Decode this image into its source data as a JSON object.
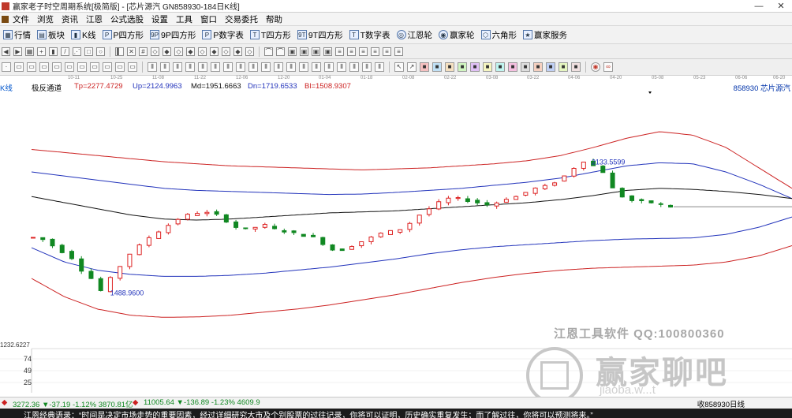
{
  "window": {
    "title": "赢家老子时空周期系统[极简版] - [芯片源汽  GN858930-184日K线]",
    "minimize": "—",
    "close": "✕"
  },
  "menu": [
    "文件",
    "浏览",
    "资讯",
    "江恩",
    "公式选股",
    "设置",
    "工具",
    "窗口",
    "交易委托",
    "帮助"
  ],
  "toolbar": [
    {
      "label": "行情",
      "icon": "grid-icon"
    },
    {
      "label": "板块",
      "icon": "block-icon"
    },
    {
      "label": "K线",
      "icon": "kline-icon"
    },
    {
      "label": "P四方形",
      "icon": "P"
    },
    {
      "label": "9P四方形",
      "icon": "9P"
    },
    {
      "label": "P数字表",
      "icon": "P"
    },
    {
      "label": "T四方形",
      "icon": "T"
    },
    {
      "label": "9T四方形",
      "icon": "9T"
    },
    {
      "label": "T数字表",
      "icon": "T"
    },
    {
      "label": "江恩轮",
      "icon": "wheel-icon"
    },
    {
      "label": "赢家轮",
      "icon": "wheel-icon"
    },
    {
      "label": "六角形",
      "icon": "hexagon-icon"
    },
    {
      "label": "赢家服务",
      "icon": "service-icon"
    }
  ],
  "date_ticks": [
    "10-11",
    "10-25",
    "11-08",
    "11-22",
    "12-06",
    "12-20",
    "01-04",
    "01-18",
    "02-08",
    "02-22",
    "03-08",
    "03-22",
    "04-06",
    "04-20",
    "05-08",
    "05-23",
    "06-06",
    "06-20"
  ],
  "indicator": {
    "panel_label": "K线",
    "name": "极反通道",
    "tp": "Tp=2277.4729",
    "up": "Up=2124.9963",
    "md": "Md=1951.6663",
    "dn": "Dn=1719.6533",
    "bl": "Bl=1508.9307",
    "security": "858930  芯片源汽"
  },
  "annotations": {
    "high": "2133.5599",
    "low": "1488.9600",
    "left_axis_value": "1232.6227"
  },
  "sub_axis": [
    "74",
    "49",
    "25"
  ],
  "status": {
    "sh": "3272.36 ▼-37.19 -1.12% 3870.81亿",
    "sz": "11005.64 ▼-136.89 -1.23% 4609.9",
    "right": "收858930日线"
  },
  "ticker": "江恩经典语录：“时间是决定市场走势的重要因素，经过详细研究大市及个别股票的过往记录，你将可以证明，历史确实重复发生；而了解过往，你将可以预测将来。”",
  "watermark": {
    "line1": "江恩工具软件 QQ:100800360",
    "line2": "赢家聊吧",
    "line3": "jiaoba.w...t"
  },
  "colors": {
    "tp_line": "#cc2222",
    "up_line": "#2233bb",
    "md_line": "#111111",
    "candle_up": "#dd2222",
    "candle_down": "#118822"
  },
  "chart_data": {
    "type": "candlestick",
    "ylim": [
      1232.6227,
      2450
    ],
    "x_ticks": [
      "10-11",
      "10-25",
      "11-08",
      "11-22",
      "12-06",
      "12-20",
      "01-04",
      "01-18",
      "02-08",
      "02-22",
      "03-08",
      "03-22",
      "04-06",
      "04-20",
      "05-08",
      "05-23",
      "06-06",
      "06-20"
    ],
    "price_path": [
      1760,
      1750,
      1720,
      1690,
      1660,
      1600,
      1560,
      1500,
      1560,
      1620,
      1680,
      1720,
      1760,
      1790,
      1820,
      1850,
      1870,
      1880,
      1880,
      1870,
      1840,
      1810,
      1800,
      1810,
      1820,
      1800,
      1790,
      1780,
      1770,
      1760,
      1730,
      1700,
      1700,
      1720,
      1740,
      1760,
      1780,
      1790,
      1800,
      1830,
      1870,
      1900,
      1930,
      1950,
      1950,
      1940,
      1930,
      1920,
      1930,
      1950,
      1960,
      1980,
      2000,
      2010,
      2030,
      2060,
      2100,
      2133,
      2110,
      2080,
      2000,
      1960,
      1940,
      1935,
      1930,
      1920,
      1910
    ],
    "series": [
      {
        "name": "Tp",
        "values": [
          2190,
          2175,
          2160,
          2145,
          2130,
          2120,
          2110,
          2105,
          2100,
          2095,
          2090,
          2095,
          2100,
          2110,
          2120,
          2135,
          2160,
          2200,
          2245,
          2277,
          2260,
          2200,
          2100,
          2000
        ]
      },
      {
        "name": "Up",
        "values": [
          2080,
          2060,
          2040,
          2020,
          2000,
          1990,
          1985,
          1980,
          1975,
          1970,
          1972,
          1980,
          1990,
          2000,
          2015,
          2030,
          2050,
          2080,
          2110,
          2125,
          2120,
          2080,
          2020,
          1950
        ]
      },
      {
        "name": "Md",
        "values": [
          1960,
          1930,
          1900,
          1870,
          1850,
          1845,
          1850,
          1860,
          1870,
          1880,
          1885,
          1890,
          1900,
          1910,
          1920,
          1930,
          1945,
          1965,
          1990,
          2000,
          1995,
          1985,
          1970,
          1950
        ]
      },
      {
        "name": "Dn",
        "values": [
          1710,
          1640,
          1600,
          1580,
          1570,
          1570,
          1575,
          1585,
          1600,
          1615,
          1635,
          1655,
          1680,
          1700,
          1715,
          1725,
          1735,
          1745,
          1752,
          1755,
          1758,
          1775,
          1810,
          1860
        ]
      },
      {
        "name": "Bl",
        "values": [
          1560,
          1470,
          1410,
          1380,
          1370,
          1372,
          1380,
          1395,
          1410,
          1430,
          1455,
          1480,
          1510,
          1540,
          1565,
          1585,
          1600,
          1610,
          1615,
          1620,
          1625,
          1640,
          1670,
          1720
        ]
      }
    ]
  }
}
